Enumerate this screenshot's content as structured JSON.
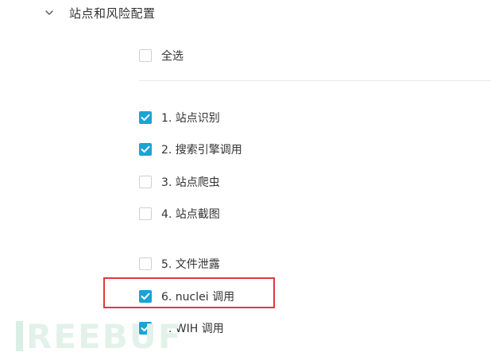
{
  "section": {
    "title": "站点和风险配置",
    "expand_icon": "chevron-down-icon"
  },
  "select_all": {
    "label": "全选",
    "checked": false
  },
  "options": [
    {
      "label": "1. 站点识别",
      "checked": true
    },
    {
      "label": "2. 搜索引擎调用",
      "checked": true
    },
    {
      "label": "3. 站点爬虫",
      "checked": false
    },
    {
      "label": "4. 站点截图",
      "checked": false
    },
    {
      "label": "5. 文件泄露",
      "checked": false
    },
    {
      "label": "6. nuclei 调用",
      "checked": true
    },
    {
      "label": "7. WIH 调用",
      "checked": true
    }
  ],
  "annotation": {
    "highlighted_option": "6. nuclei 调用",
    "color": "#e0393c"
  },
  "watermark": {
    "text": "REEBUF"
  },
  "colors": {
    "checkbox_checked": "#1aa3d6",
    "checkbox_border": "#d0d0d0",
    "text": "#333333"
  }
}
